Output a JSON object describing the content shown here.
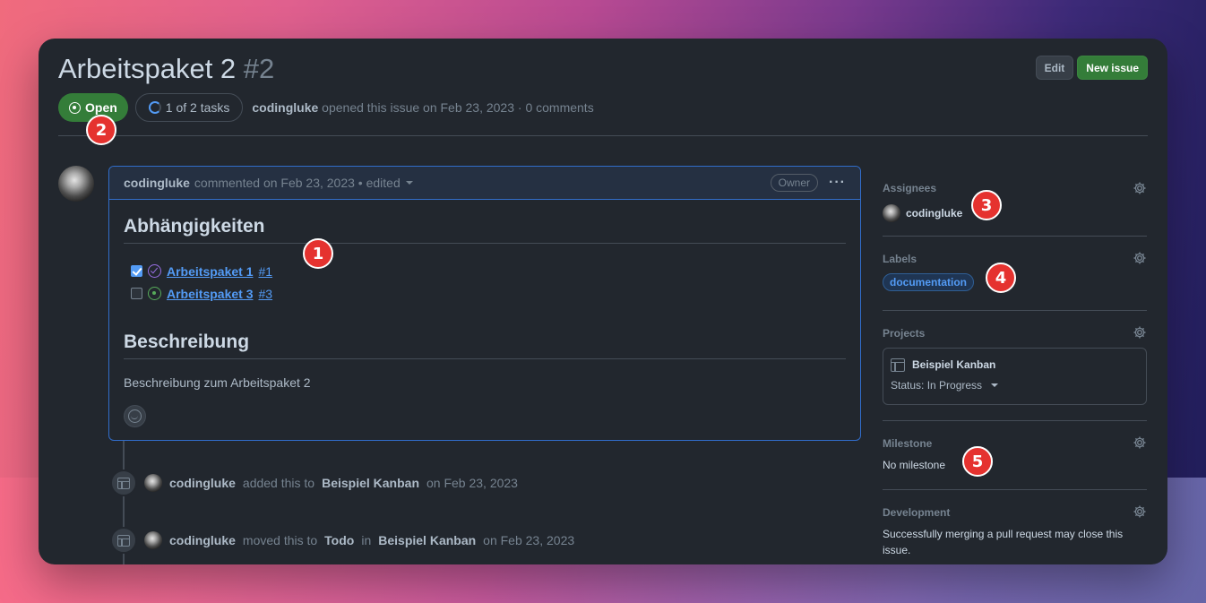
{
  "issue": {
    "title": "Arbeitspaket 2",
    "number": "#2",
    "state": "Open",
    "tasks": "1 of 2 tasks",
    "author": "codingluke",
    "opened_text": "opened this issue on Feb 23, 2023 · 0 comments"
  },
  "header": {
    "edit_label": "Edit",
    "new_issue_label": "New issue"
  },
  "comment": {
    "author": "codingluke",
    "meta": "commented on Feb 23, 2023 • edited",
    "owner_badge": "Owner",
    "more": "···",
    "heading1": "Abhängigkeiten",
    "tasks": [
      {
        "checked": true,
        "state": "closed",
        "title": "Arbeitspaket 1",
        "ref": "#1"
      },
      {
        "checked": false,
        "state": "open",
        "title": "Arbeitspaket 3",
        "ref": "#3"
      }
    ],
    "heading2": "Beschreibung",
    "body": "Beschreibung zum Arbeitspaket 2"
  },
  "timeline": [
    {
      "actor": "codingluke",
      "pre": "added this to",
      "target": "Beispiel Kanban",
      "mid": "",
      "target2": "",
      "post": "on Feb 23, 2023"
    },
    {
      "actor": "codingluke",
      "pre": "moved this to",
      "target": "Todo",
      "mid": "in",
      "target2": "Beispiel Kanban",
      "post": "on Feb 23, 2023"
    }
  ],
  "sidebar": {
    "assignees": {
      "title": "Assignees",
      "user": "codingluke"
    },
    "labels": {
      "title": "Labels",
      "label": "documentation"
    },
    "projects": {
      "title": "Projects",
      "project": "Beispiel Kanban",
      "status": "Status: In Progress"
    },
    "milestone": {
      "title": "Milestone",
      "value": "No milestone"
    },
    "development": {
      "title": "Development",
      "text": "Successfully merging a pull request may close this issue."
    }
  },
  "markers": [
    "1",
    "2",
    "3",
    "4",
    "5"
  ],
  "colors": {
    "open_green": "#347d39",
    "link_blue": "#539bf5",
    "marker_red": "#e5322f",
    "surface": "#22272e"
  }
}
